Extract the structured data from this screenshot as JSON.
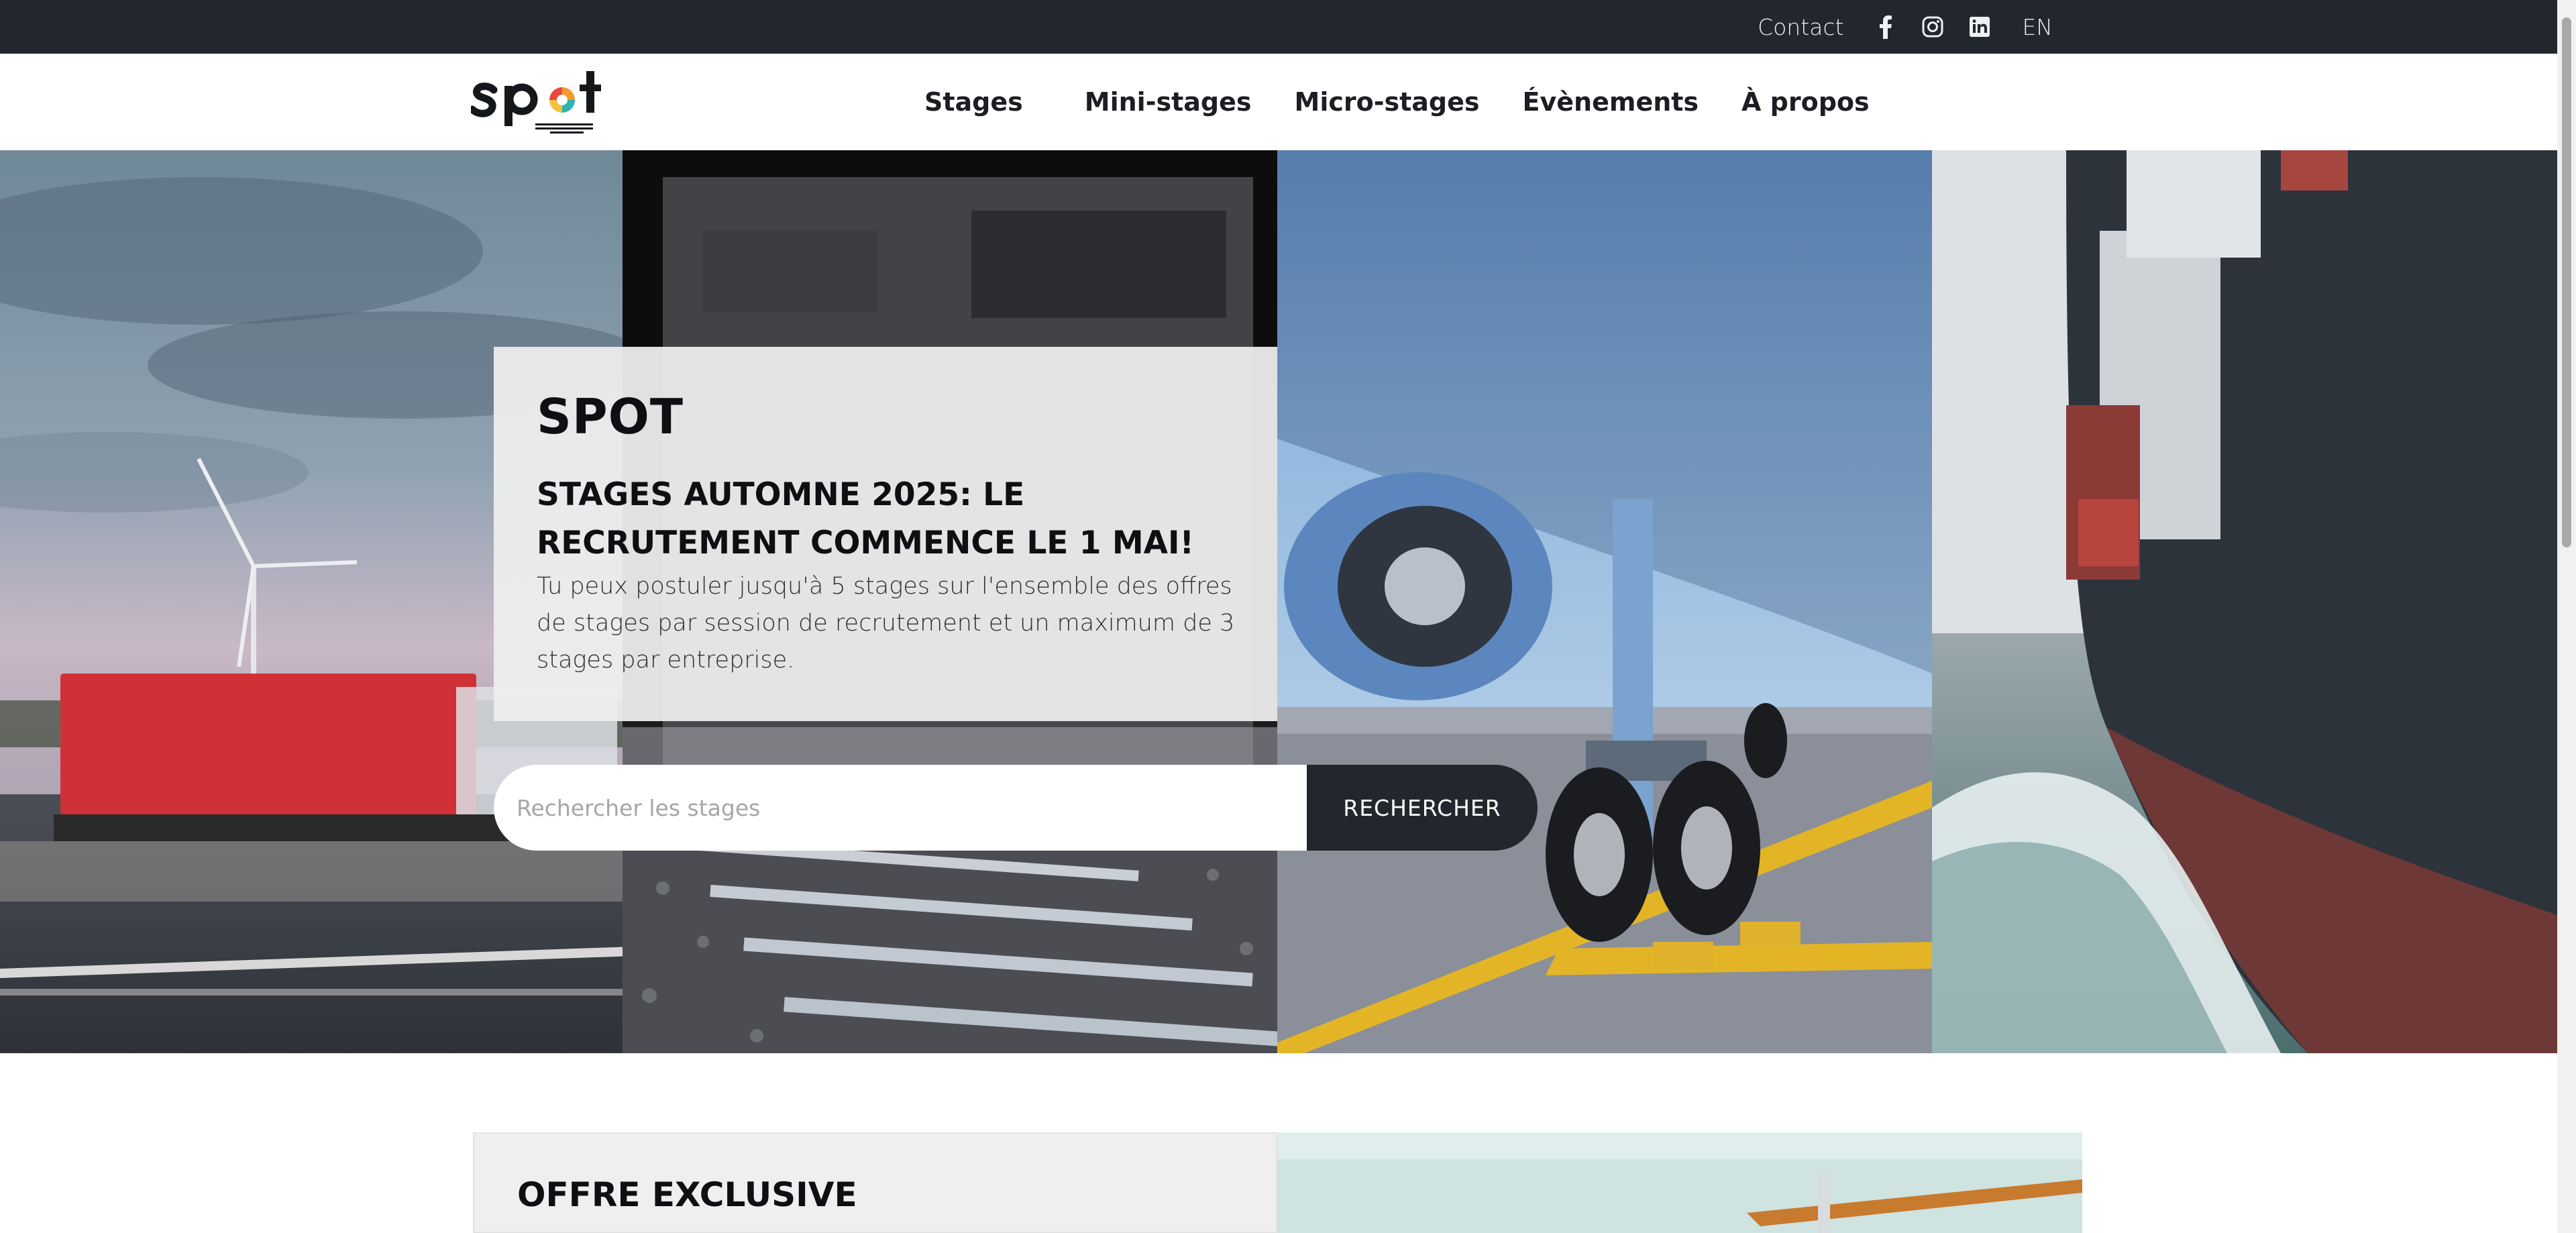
{
  "topbar": {
    "contact_label": "Contact",
    "social": [
      {
        "name": "facebook-icon"
      },
      {
        "name": "instagram-icon"
      },
      {
        "name": "linkedin-icon"
      }
    ],
    "language_label": "EN",
    "colors": {
      "background": "#22272d",
      "text": "#eef0f2"
    }
  },
  "header": {
    "logo_text": "spot",
    "logo_tagline": "SERVICE DE PLACEMENT OPPORTUNITÉS TRANSALTÉGIA",
    "nav": [
      {
        "label": "Stages"
      },
      {
        "label": "Mini-stages"
      },
      {
        "label": "Micro-stages"
      },
      {
        "label": "Évènements"
      },
      {
        "label": "À propos"
      }
    ]
  },
  "hero": {
    "brand": "SPOT",
    "headline": "STAGES AUTOMNE 2025: LE RECRUTEMENT COMMENCE LE 1 MAI!",
    "description": "Tu peux postuler jusqu'à 5 stages sur l'ensemble des offres de stages par session de recrutement et un maximum de 3 stages par entreprise.",
    "search": {
      "placeholder": "Rechercher les stages",
      "value": "",
      "button_label": "RECHERCHER"
    },
    "panels": [
      "truck-highway-photo",
      "train-rails-photo",
      "airplane-landing-gear-photo",
      "container-ship-photo"
    ]
  },
  "offer": {
    "title": "OFFRE EXCLUSIVE"
  },
  "colors": {
    "dark": "#22272d",
    "card": "#eeeeee",
    "logo_orange": "#f29a2e",
    "logo_teal": "#29b5b0",
    "logo_red": "#e8483f",
    "logo_yellow": "#f6c23e"
  }
}
